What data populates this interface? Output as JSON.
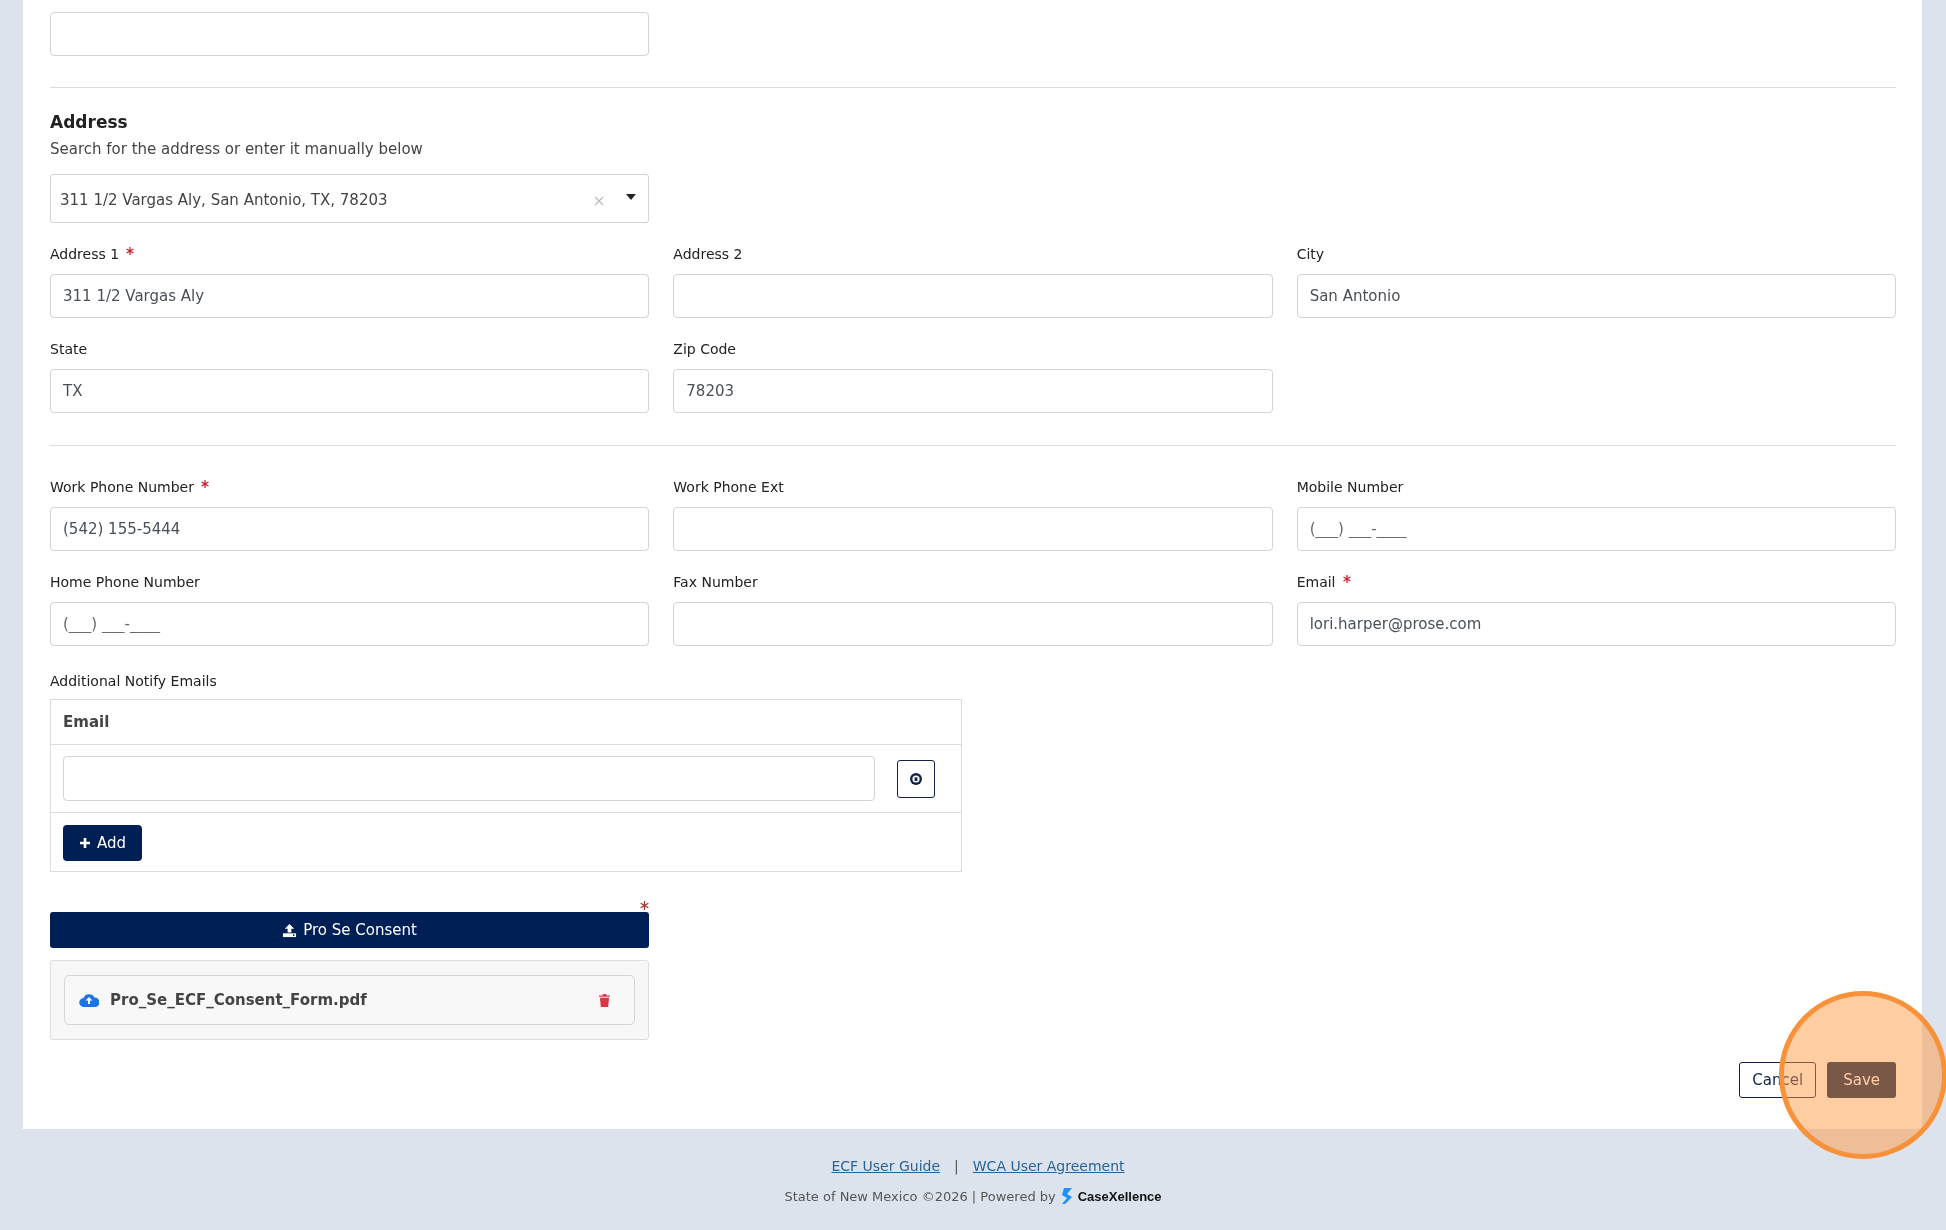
{
  "address": {
    "heading": "Address",
    "hint": "Search for the address or enter it manually below",
    "search": {
      "value": "311 1/2 Vargas Aly, San Antonio, TX, 78203"
    }
  },
  "address_fields": [
    {
      "label": "Address 1",
      "required": true,
      "value": "311 1/2 Vargas Aly"
    },
    {
      "label": "Address 2",
      "required": false
    },
    {
      "label": "City",
      "required": false,
      "value": "San Antonio"
    },
    {
      "label": "State",
      "required": false,
      "value": "TX"
    },
    {
      "label": "Zip Code",
      "required": false,
      "value": "78203"
    }
  ],
  "contact_fields": [
    {
      "label": "Work Phone Number",
      "required": true,
      "value": "(542) 155-5444"
    },
    {
      "label": "Work Phone Ext",
      "required": false
    },
    {
      "label": "Mobile Number",
      "required": false,
      "placeholder": "(___) ___-____"
    },
    {
      "label": "Home Phone Number",
      "required": false,
      "placeholder": "(___) ___-____"
    },
    {
      "label": "Fax Number",
      "required": false
    },
    {
      "label": "Email",
      "required": true,
      "value": "lori.harper@prose.com"
    }
  ],
  "notify": {
    "label": "Additional Notify Emails",
    "column": "Email",
    "add_button": "Add"
  },
  "upload": {
    "button": "Pro Se Consent",
    "required": true,
    "file": "Pro_Se_ECF_Consent_Form.pdf"
  },
  "actions": [
    {
      "label": "Cancel",
      "kind": "secondary"
    },
    {
      "label": "Save",
      "kind": "primary"
    }
  ],
  "footer": {
    "links": [
      "ECF User Guide",
      "WCA User Agreement"
    ],
    "separator": "|",
    "copyright": "State of New Mexico ©2026 | Powered by",
    "brand": "CaseXellence"
  }
}
